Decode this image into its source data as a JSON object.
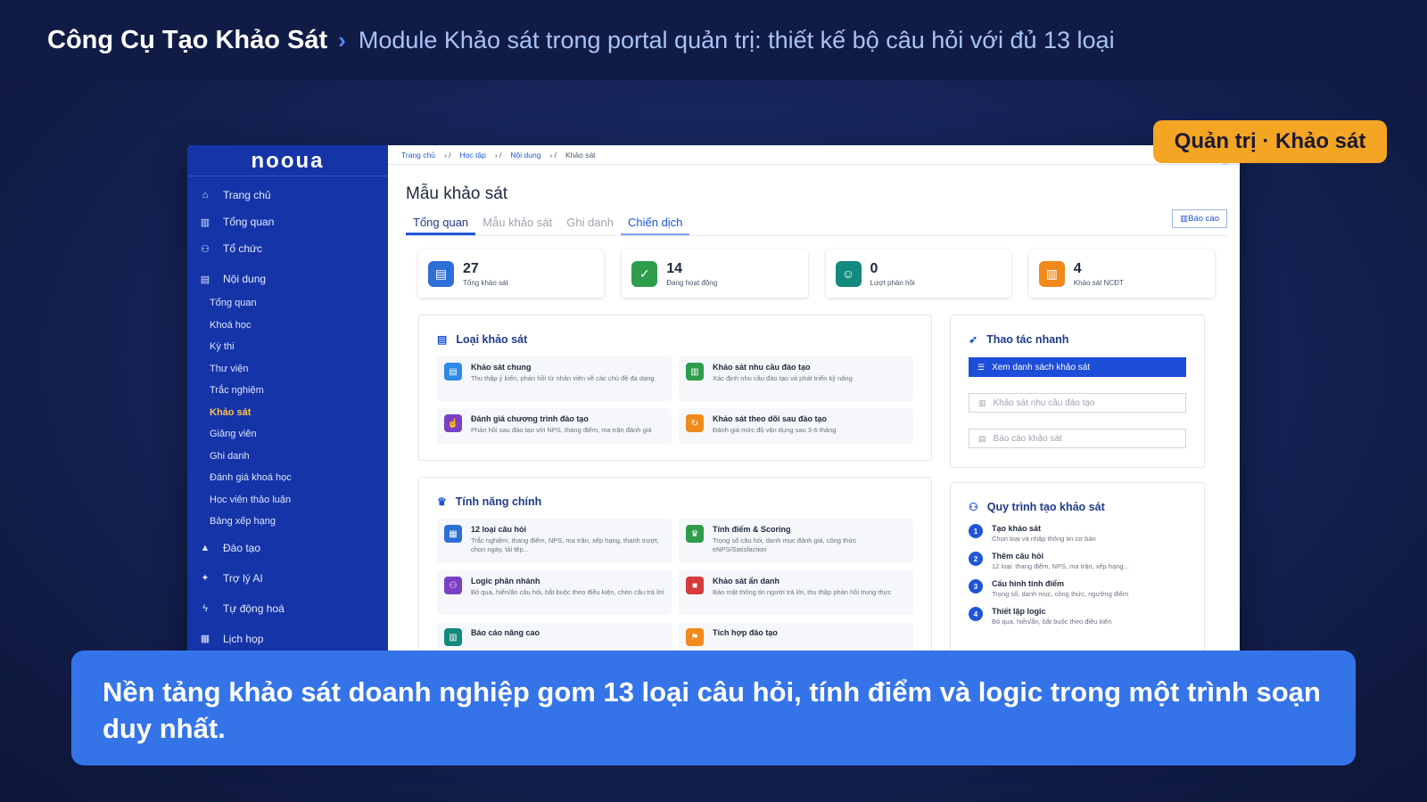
{
  "header": {
    "title": "Công Cụ Tạo Khảo Sát",
    "separator": "›",
    "subtitle": "Module Khảo sát trong portal quản trị: thiết kế bộ câu hỏi với đủ 13 loại"
  },
  "badge": "Quản trị · Khảo sát",
  "app": {
    "logo": "nooua",
    "nav": [
      {
        "icon": "home-icon",
        "glyph": "⌂",
        "label": "Trang chủ"
      },
      {
        "icon": "chart-icon",
        "glyph": "▥",
        "label": "Tổng quan"
      },
      {
        "icon": "org-icon",
        "glyph": "⚇",
        "label": "Tổ chức"
      },
      {
        "icon": "book-icon",
        "glyph": "▤",
        "label": "Nội dung"
      }
    ],
    "subnav": [
      "Tổng quan",
      "Khoá học",
      "Kỳ thi",
      "Thư viện",
      "Trắc nghiệm",
      "Khảo sát",
      "Giảng viên",
      "Ghi danh",
      "Đánh giá khoá học",
      "Học viên thảo luận",
      "Bảng xếp hạng"
    ],
    "nav2": [
      {
        "icon": "graduation-icon",
        "glyph": "▲",
        "label": "Đào tạo"
      },
      {
        "icon": "sparkle-icon",
        "glyph": "✦",
        "label": "Trợ lý AI"
      },
      {
        "icon": "bolt-icon",
        "glyph": "ϟ",
        "label": "Tự động hoá"
      },
      {
        "icon": "calendar-icon",
        "glyph": "▦",
        "label": "Lịch họp"
      }
    ],
    "breadcrumb": [
      "Trang chủ",
      "Học tập",
      "Nội dung",
      "Khảo sát"
    ],
    "page_title": "Mẫu khảo sát",
    "tabs": [
      "Tổng quan",
      "Mẫu khảo sát",
      "Ghi danh",
      "Chiến dịch"
    ],
    "report_button": "Báo cáo",
    "stats": [
      {
        "value": "27",
        "label": "Tổng khảo sát",
        "color": "#2e6fd6",
        "glyph": "▤"
      },
      {
        "value": "14",
        "label": "Đang hoạt động",
        "color": "#2e9d4b",
        "glyph": "✓"
      },
      {
        "value": "0",
        "label": "Lượt phản hồi",
        "color": "#138a7e",
        "glyph": "☺"
      },
      {
        "value": "4",
        "label": "Khảo sát NCĐT",
        "color": "#f08a1a",
        "glyph": "▥"
      }
    ],
    "types": {
      "title": "Loại khảo sát",
      "items": [
        {
          "title": "Khảo sát chung",
          "desc": "Thu thập ý kiến, phản hồi từ nhân viên về các chủ đề đa dạng",
          "color": "#2e8ae6",
          "glyph": "▤"
        },
        {
          "title": "Khảo sát nhu cầu đào tạo",
          "desc": "Xác định nhu cầu đào tạo và phát triển kỹ năng",
          "color": "#2e9d4b",
          "glyph": "▥"
        },
        {
          "title": "Đánh giá chương trình đào tạo",
          "desc": "Phản hồi sau đào tạo với NPS, thang điểm, ma trận đánh giá",
          "color": "#7b3fc4",
          "glyph": "☝"
        },
        {
          "title": "Khảo sát theo dõi sau đào tạo",
          "desc": "Đánh giá mức độ vận dụng sau 3-6 tháng",
          "color": "#f08a1a",
          "glyph": "↻"
        }
      ]
    },
    "features": {
      "title": "Tính năng chính",
      "items": [
        {
          "title": "12 loại câu hỏi",
          "desc": "Trắc nghiệm, thang điểm, NPS, ma trận, xếp hạng, thanh trượt, chọn ngày, tải tệp...",
          "color": "#2e6fd6",
          "glyph": "▦"
        },
        {
          "title": "Tính điểm & Scoring",
          "desc": "Trọng số câu hỏi, danh mục đánh giá, công thức eNPS/Satisfaction",
          "color": "#2e9d4b",
          "glyph": "♛"
        },
        {
          "title": "Logic phân nhánh",
          "desc": "Bỏ qua, hiển/ẩn câu hỏi, bắt buộc theo điều kiện, chèn câu trả lời",
          "color": "#7b3fc4",
          "glyph": "⚇"
        },
        {
          "title": "Khảo sát ẩn danh",
          "desc": "Bảo mật thông tin người trả lời, thu thập phản hồi trung thực",
          "color": "#d63a3a",
          "glyph": "■"
        },
        {
          "title": "Báo cáo nâng cao",
          "desc": "",
          "color": "#138a7e",
          "glyph": "▥"
        },
        {
          "title": "Tích hợp đào tạo",
          "desc": "",
          "color": "#f08a1a",
          "glyph": "⚑"
        }
      ]
    },
    "quick": {
      "title": "Thao tác nhanh",
      "primary": "Xem danh sách khảo sát",
      "links": [
        "Khảo sát nhu cầu đào tạo",
        "Báo cáo khảo sát"
      ]
    },
    "process": {
      "title": "Quy trình tạo khảo sát",
      "steps": [
        {
          "n": "1",
          "title": "Tạo khảo sát",
          "desc": "Chọn loại và nhập thông tin cơ bản"
        },
        {
          "n": "2",
          "title": "Thêm câu hỏi",
          "desc": "12 loại: thang điểm, NPS, ma trận, xếp hạng..."
        },
        {
          "n": "3",
          "title": "Cấu hình tính điểm",
          "desc": "Trọng số, danh mục, công thức, ngưỡng điểm"
        },
        {
          "n": "4",
          "title": "Thiết lập logic",
          "desc": "Bỏ qua, hiển/ẩn, bắt buộc theo điều kiện"
        }
      ]
    }
  },
  "caption": "Nền tảng khảo sát doanh nghiệp gom 13 loại câu hỏi, tính điểm và logic trong một trình soạn duy nhất."
}
